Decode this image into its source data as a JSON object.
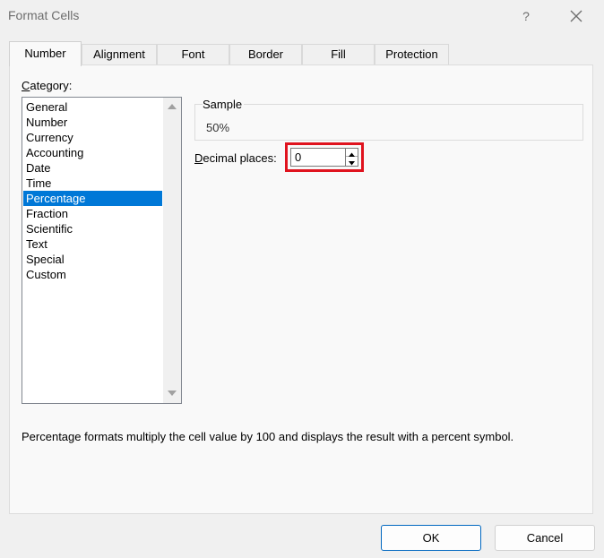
{
  "window": {
    "title": "Format Cells",
    "help_label": "?"
  },
  "tabs": [
    {
      "label": "Number",
      "active": true
    },
    {
      "label": "Alignment",
      "active": false
    },
    {
      "label": "Font",
      "active": false
    },
    {
      "label": "Border",
      "active": false
    },
    {
      "label": "Fill",
      "active": false
    },
    {
      "label": "Protection",
      "active": false
    }
  ],
  "category": {
    "label_mnemonic": "C",
    "label_rest": "ategory:",
    "items": [
      "General",
      "Number",
      "Currency",
      "Accounting",
      "Date",
      "Time",
      "Percentage",
      "Fraction",
      "Scientific",
      "Text",
      "Special",
      "Custom"
    ],
    "selected": "Percentage"
  },
  "sample": {
    "label": "Sample",
    "value": "50%"
  },
  "decimal_places": {
    "label_mnemonic": "D",
    "label_rest": "ecimal places:",
    "value": "0"
  },
  "description": "Percentage formats multiply the cell value by 100 and displays the result with a percent symbol.",
  "buttons": {
    "ok": "OK",
    "cancel": "Cancel"
  },
  "colors": {
    "selection": "#0078d7",
    "highlight_border": "#e0131e",
    "primary_border": "#0067c0"
  },
  "icons": {
    "close": "close-icon",
    "scroll_up": "scroll-up-arrow-icon",
    "scroll_down": "scroll-down-arrow-icon",
    "spin_up": "spin-up-arrow-icon",
    "spin_down": "spin-down-arrow-icon"
  }
}
